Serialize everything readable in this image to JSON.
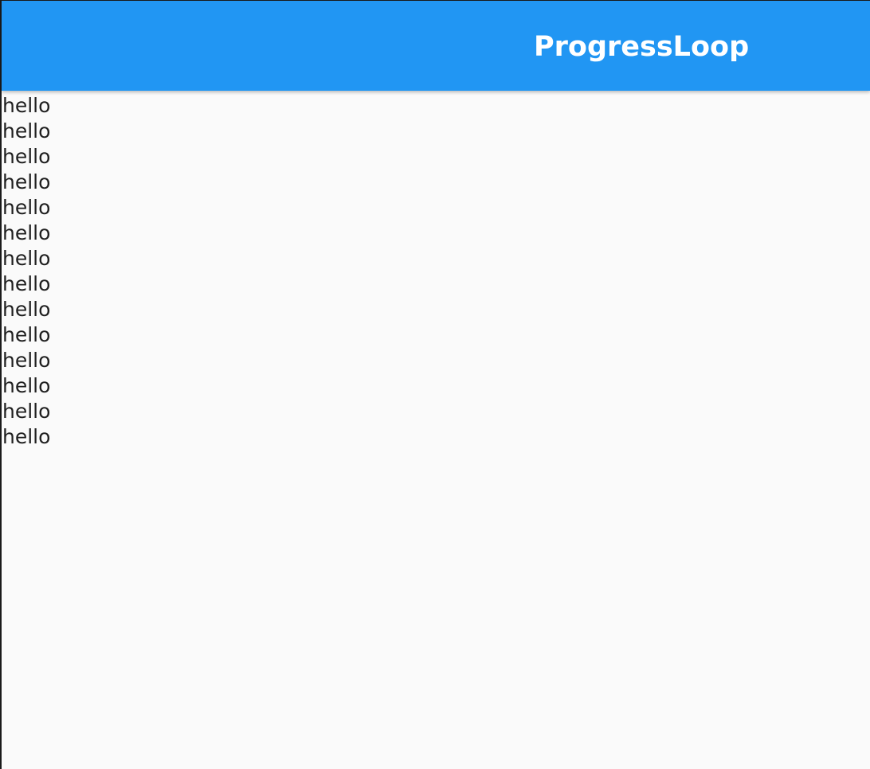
{
  "app_bar": {
    "title": "ProgressLoop",
    "color": "#2196F3"
  },
  "list": {
    "items": [
      "hello",
      "hello",
      "hello",
      "hello",
      "hello",
      "hello",
      "hello",
      "hello",
      "hello",
      "hello",
      "hello",
      "hello",
      "hello",
      "hello"
    ]
  }
}
